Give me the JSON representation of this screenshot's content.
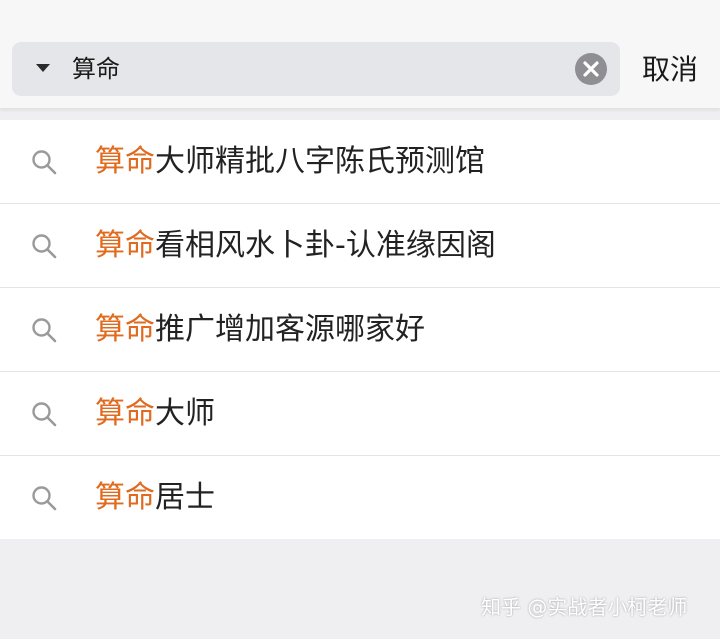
{
  "search": {
    "query": "算命",
    "cancel_label": "取消"
  },
  "suggestions": [
    {
      "highlight": "算命",
      "rest": "大师精批八字陈氏预测馆"
    },
    {
      "highlight": "算命",
      "rest": "看相风水卜卦-认准缘因阁"
    },
    {
      "highlight": "算命",
      "rest": "推广增加客源哪家好"
    },
    {
      "highlight": "算命",
      "rest": "大师"
    },
    {
      "highlight": "算命",
      "rest": "居士"
    }
  ],
  "watermark": "知乎 @实战者小柯老师",
  "colors": {
    "highlight": "#e06a1e",
    "background": "#efeff1",
    "search_box": "#e5e6e9"
  },
  "icons": {
    "dropdown": "caret-down-icon",
    "clear": "clear-icon",
    "suggestion": "search-icon"
  }
}
